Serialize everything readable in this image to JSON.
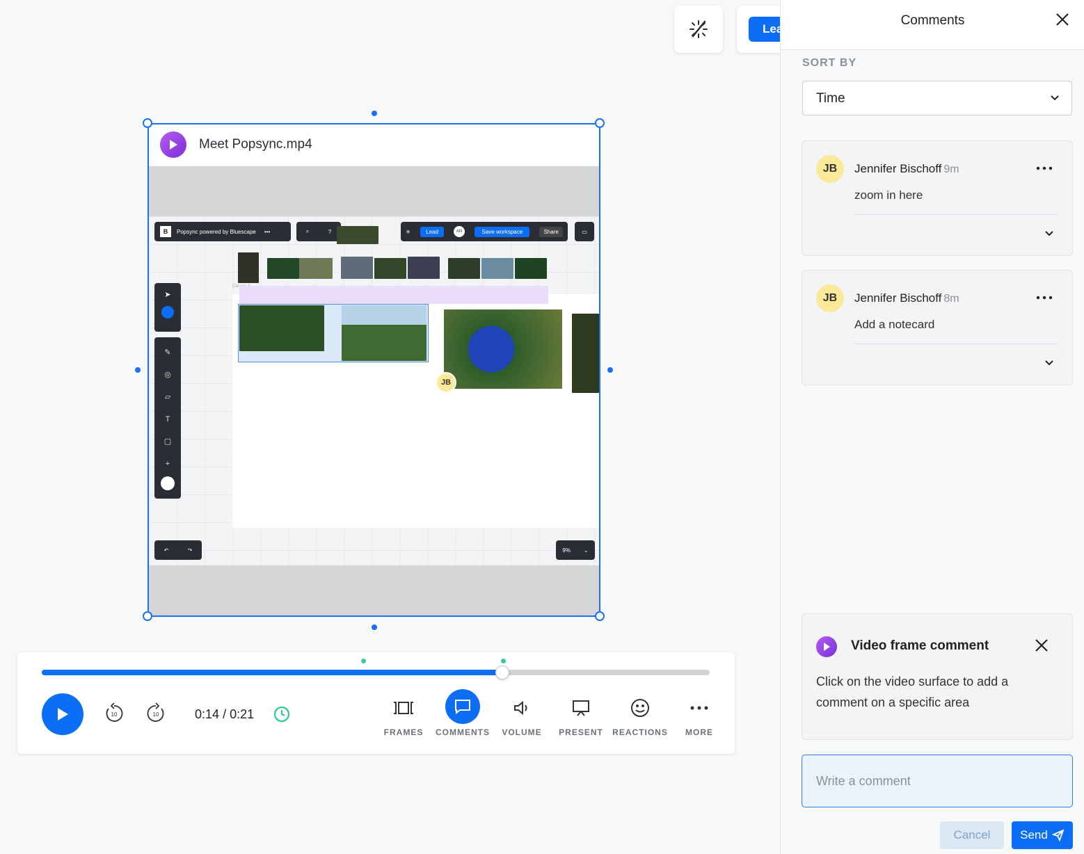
{
  "top_bar": {
    "lead_label": "Lea"
  },
  "video_card": {
    "title": "Meet Popsync.mp4",
    "inner": {
      "app_title": "Popsync powered by Bluescape",
      "lead": "Lead",
      "avatar": "AN",
      "save": "Save workspace",
      "share": "Share",
      "zoom": "9%",
      "cursor_chip": "JB",
      "canvas_label": "Canvas 4"
    }
  },
  "player": {
    "progress_fraction": 0.69,
    "time_current": "0:14",
    "time_separator": "/",
    "time_total": "0:21",
    "skip_back_label": "10",
    "skip_fwd_label": "10",
    "controls": [
      {
        "label": "FRAMES",
        "icon": "frames-icon"
      },
      {
        "label": "COMMENTS",
        "icon": "comment-icon",
        "active": true
      },
      {
        "label": "VOLUME",
        "icon": "volume-icon"
      },
      {
        "label": "PRESENT",
        "icon": "present-icon"
      },
      {
        "label": "REACTIONS",
        "icon": "smile-icon"
      },
      {
        "label": "MORE",
        "icon": "more-icon"
      }
    ]
  },
  "comments_panel": {
    "title": "Comments",
    "sort_by_label": "SORT BY",
    "sort_value": "Time",
    "comments": [
      {
        "initials": "JB",
        "author": "Jennifer Bischoff",
        "time": "9m",
        "text": "zoom in here"
      },
      {
        "initials": "JB",
        "author": "Jennifer Bischoff",
        "time": "8m",
        "text": "Add a notecard"
      }
    ],
    "video_frame_comment": {
      "title": "Video frame comment",
      "text": "Click on the video surface to add a comment on a specific area"
    },
    "input_placeholder": "Write a comment",
    "cancel_label": "Cancel",
    "send_label": "Send"
  },
  "colors": {
    "accent": "#0c6ef5",
    "avatar_bg": "#fbe99a",
    "marker": "#3ec99c",
    "purple": "#9b45e4"
  }
}
